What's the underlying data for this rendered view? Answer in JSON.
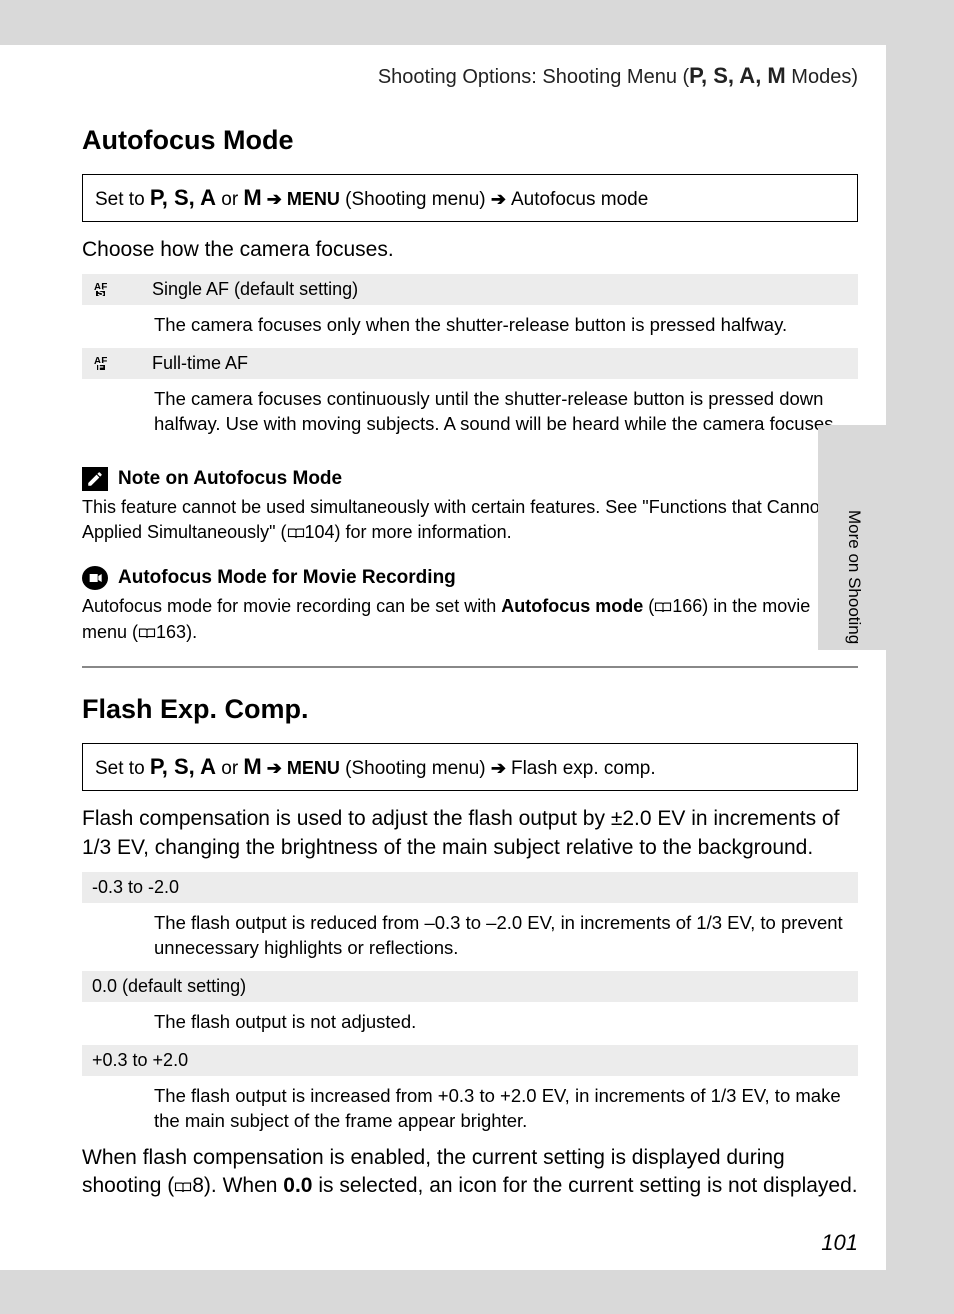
{
  "header": {
    "prefix": "Shooting Options: Shooting Menu (",
    "modes": "P, S, A, M",
    "suffix": " Modes)"
  },
  "section1": {
    "title": "Autofocus Mode",
    "path_prefix": "Set to ",
    "path_modes_text": "P, S, A",
    "path_or": " or ",
    "path_lastmode": "M",
    "path_arrow": " ➔ ",
    "path_menu": "MENU",
    "path_menu_label": " (Shooting menu) ",
    "path_arrow2": "➔ ",
    "path_item": "Autofocus mode",
    "intro": "Choose how the camera focuses.",
    "opts": [
      {
        "icon_top": "AF",
        "icon_bot": "S",
        "label": "Single AF (default setting)",
        "body": "The camera focuses only when the shutter-release button is pressed halfway."
      },
      {
        "icon_top": "AF",
        "icon_bot": "F",
        "label": "Full-time AF",
        "body": "The camera focuses continuously until the shutter-release button is pressed down halfway. Use with moving subjects. A sound will be heard while the camera focuses."
      }
    ],
    "note1_title": "Note on Autofocus Mode",
    "note1_body_a": "This feature cannot be used simultaneously with certain features. See \"Functions that Cannot be Applied Simultaneously\" (",
    "note1_ref": "104",
    "note1_body_b": ") for more information.",
    "note2_title": "Autofocus Mode for Movie Recording",
    "note2_body_a": "Autofocus mode for movie recording can be set with ",
    "note2_bold": "Autofocus mode",
    "note2_body_b": " (",
    "note2_ref1": "166",
    "note2_body_c": ") in the movie menu (",
    "note2_ref2": "163",
    "note2_body_d": ")."
  },
  "section2": {
    "title": "Flash Exp. Comp.",
    "path_item": "Flash exp. comp.",
    "intro": "Flash compensation is used to adjust the flash output by ±2.0 EV in increments of 1/3 EV, changing the brightness of the main subject relative to the background.",
    "opts": [
      {
        "label": "-0.3 to -2.0",
        "body": "The flash output is reduced from –0.3 to –2.0 EV, in increments of 1/3 EV, to prevent unnecessary highlights or reflections."
      },
      {
        "label": "0.0 (default setting)",
        "body": "The flash output is not adjusted."
      },
      {
        "label": "+0.3 to +2.0",
        "body": "The flash output is increased from +0.3 to +2.0 EV, in increments of 1/3 EV, to make the main subject of the frame appear brighter."
      }
    ],
    "outro_a": "When flash compensation is enabled, the current setting is displayed during shooting (",
    "outro_ref": "8",
    "outro_b": "). When ",
    "outro_bold": "0.0",
    "outro_c": " is selected, an icon for the current setting is not displayed."
  },
  "side_label": "More on Shooting",
  "page_number": "101"
}
